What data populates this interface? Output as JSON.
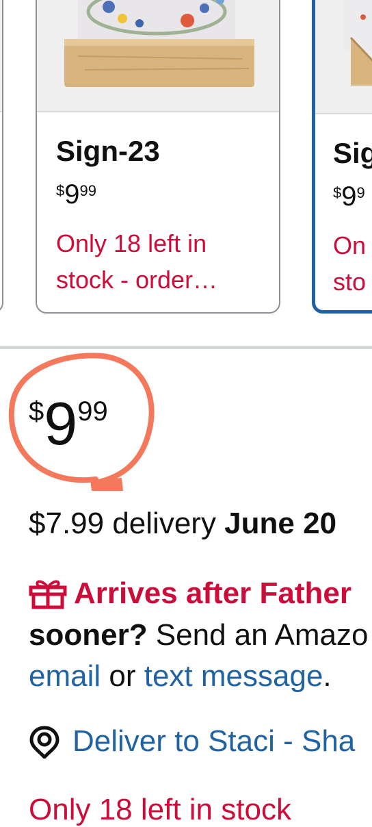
{
  "carousel": {
    "cards": [
      {
        "title": "",
        "price_sup": "",
        "price_whole": "",
        "price_frac": "",
        "stock_line1": "",
        "stock_line2": ""
      },
      {
        "title": "Sign-23",
        "price_sup": "$",
        "price_whole": "9",
        "price_frac": "99",
        "stock_line1": "Only 18 left in",
        "stock_line2": "stock - order…"
      },
      {
        "title": "Sig",
        "price_sup": "$",
        "price_whole": "9",
        "price_frac": "9",
        "stock_line1": "On",
        "stock_line2": "sto"
      }
    ]
  },
  "price": {
    "currency": "$",
    "whole": "9",
    "fraction": "99"
  },
  "delivery": {
    "text": "$7.99 delivery ",
    "date": "June 20"
  },
  "gift": {
    "icon": "gift-icon",
    "headline": "Arrives after Father",
    "line2_bold": "sooner?",
    "line2_text": " Send an Amazo",
    "email_link": "email",
    "or_text": " or ",
    "text_link": "text message",
    "period": "."
  },
  "deliver_to": {
    "icon": "location-pin-icon",
    "text": "Deliver to Staci - Sha"
  },
  "stock_notice": "Only 18 left in stock",
  "colors": {
    "link": "#2162a1",
    "alert": "#cc0c39",
    "selected_border": "#2162a1",
    "annotation": "#f4795c"
  }
}
